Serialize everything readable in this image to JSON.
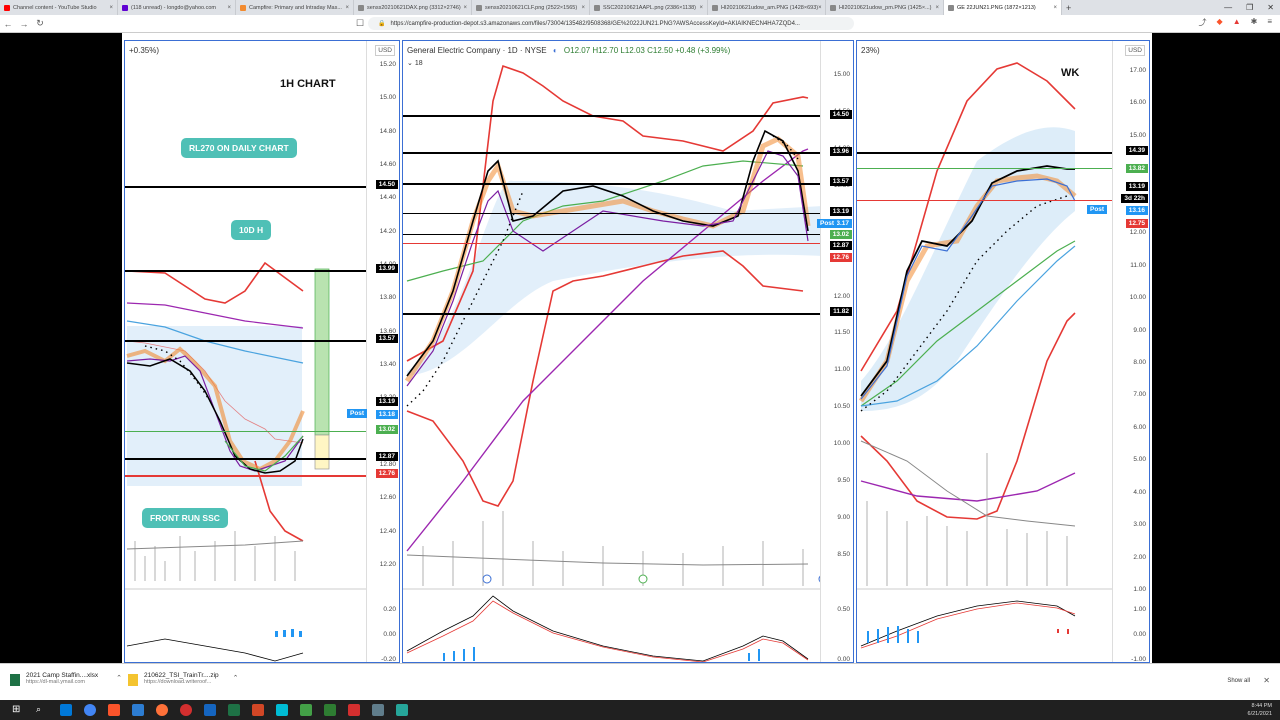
{
  "browser": {
    "tabs": [
      {
        "label": "Channel content - YouTube Studio",
        "color": "#ff0000"
      },
      {
        "label": "(118 unread) - longdo@yahoo.com",
        "color": "#6001d2"
      },
      {
        "label": "Campfire: Primary and Intraday Mas...",
        "color": "#f28b30"
      },
      {
        "label": "senss20210621DAX.png (3312×2746)",
        "color": "#888888"
      },
      {
        "label": "senss20210621CLF.png (2522×1565)",
        "color": "#888888"
      },
      {
        "label": "SSC20210621AAPL.png (2386×1138)",
        "color": "#888888"
      },
      {
        "label": "HI20210621udow_am.PNG (1428×693)",
        "color": "#888888"
      },
      {
        "label": "HI20210621udow_pm.PNG (1425×...)",
        "color": "#888888"
      },
      {
        "label": "GE 22JUN21.PNG (1872×1213)",
        "color": "#888888"
      }
    ],
    "url": "https://campfire-production-depot.s3.amazonaws.com/files/73004/135482/9508368/GE%2022JUN21.PNG?AWSAccessKeyId=AKIAIKNECN4HA7ZQD4...",
    "new_tab": "+",
    "window_controls": [
      "—",
      "❐",
      "✕"
    ]
  },
  "left_panel": {
    "header_fragment": "+0.35%)",
    "currency": "USD",
    "title_note": "1H CHART",
    "callout_rl270": "RL270 ON DAILY CHART",
    "callout_10dh": "10D H",
    "callout_front_run": "FRONT RUN SSC",
    "price_ticks": [
      "15.20",
      "15.00",
      "14.80",
      "14.60",
      "14.40",
      "14.20",
      "14.00",
      "13.80",
      "13.60",
      "13.40",
      "13.20",
      "13.00",
      "12.80",
      "12.60",
      "12.40",
      "12.20"
    ],
    "tags": [
      {
        "label": "14.50",
        "color": "#000000"
      },
      {
        "label": "13.99",
        "color": "#000000"
      },
      {
        "label": "13.57",
        "color": "#000000"
      },
      {
        "label": "13.19",
        "color": "#000000"
      },
      {
        "label": "13.18",
        "color": "#2196f3"
      },
      {
        "label": "13.02",
        "color": "#4caf50"
      },
      {
        "label": "12.87",
        "color": "#000000"
      },
      {
        "label": "12.76",
        "color": "#e53935"
      }
    ],
    "post_label": "Post",
    "osc_ticks": [
      "0.20",
      "0.00",
      "-0.20"
    ]
  },
  "mid_panel": {
    "symbol": "General Electric Company · 1D · NYSE",
    "ohlc": "O12.07 H12.70 L12.03 C12.50 +0.48 (+3.99%)",
    "indicator_count": "18",
    "price_ticks": [
      "15.00",
      "14.50",
      "14.00",
      "13.50",
      "13.00",
      "12.50",
      "12.00",
      "11.50",
      "11.00",
      "10.50",
      "10.00",
      "9.50",
      "9.00",
      "8.50"
    ],
    "tags": [
      {
        "label": "14.50",
        "color": "#000000"
      },
      {
        "label": "13.96",
        "color": "#000000"
      },
      {
        "label": "13.57",
        "color": "#000000"
      },
      {
        "label": "13.19",
        "color": "#000000"
      },
      {
        "label": "13.17",
        "color": "#2196f3"
      },
      {
        "label": "13.02",
        "color": "#4caf50"
      },
      {
        "label": "12.87",
        "color": "#000000"
      },
      {
        "label": "12.76",
        "color": "#e53935"
      },
      {
        "label": "11.82",
        "color": "#000000"
      }
    ],
    "post_label": "Post",
    "osc_ticks": [
      "0.50",
      "0.00"
    ]
  },
  "right_panel": {
    "header_fragment": "23%)",
    "currency": "USD",
    "title_note": "WK",
    "price_ticks": [
      "17.00",
      "16.00",
      "15.00",
      "14.00",
      "13.00",
      "12.00",
      "11.00",
      "10.00",
      "9.00",
      "8.00",
      "7.00",
      "6.00",
      "5.00",
      "4.00",
      "3.00",
      "2.00",
      "1.00"
    ],
    "tags": [
      {
        "label": "14.39",
        "color": "#000000"
      },
      {
        "label": "13.82",
        "color": "#4caf50"
      },
      {
        "label": "13.19",
        "color": "#000000"
      },
      {
        "label": "3d 22h",
        "color": "#000000"
      },
      {
        "label": "13.16",
        "color": "#2196f3"
      },
      {
        "label": "12.75",
        "color": "#e53935"
      }
    ],
    "post_label": "Post",
    "osc_ticks": [
      "1.00",
      "0.00",
      "-1.00"
    ]
  },
  "downloads": [
    {
      "name": "2021 Camp Staffin....xlsx",
      "source": "https://dl-mail.ymail.com"
    },
    {
      "name": "210622_TSI_TrainTr....zip",
      "source": "https://download.writeroof..."
    }
  ],
  "downloads_show_all": "Show all",
  "clock": {
    "time": "8:44 PM",
    "date": "6/21/2021"
  }
}
